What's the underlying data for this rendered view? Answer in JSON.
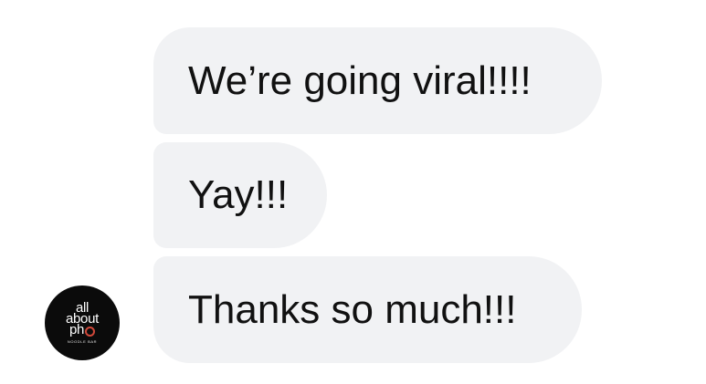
{
  "conversation": {
    "messages": [
      {
        "text": "We’re going viral!!!!"
      },
      {
        "text": "Yay!!!"
      },
      {
        "text": "Thanks so much!!!"
      }
    ]
  },
  "sender": {
    "avatar": {
      "logo_line1": "all",
      "logo_line2": "about",
      "logo_line3": "ph",
      "logo_subtitle": "NOODLE BAR",
      "icon": "swirl-icon",
      "accent_color": "#d1493a",
      "background_color": "#0b0b0b"
    }
  },
  "colors": {
    "bubble_background": "#f1f2f4",
    "bubble_text": "#111111",
    "page_background": "#ffffff"
  }
}
